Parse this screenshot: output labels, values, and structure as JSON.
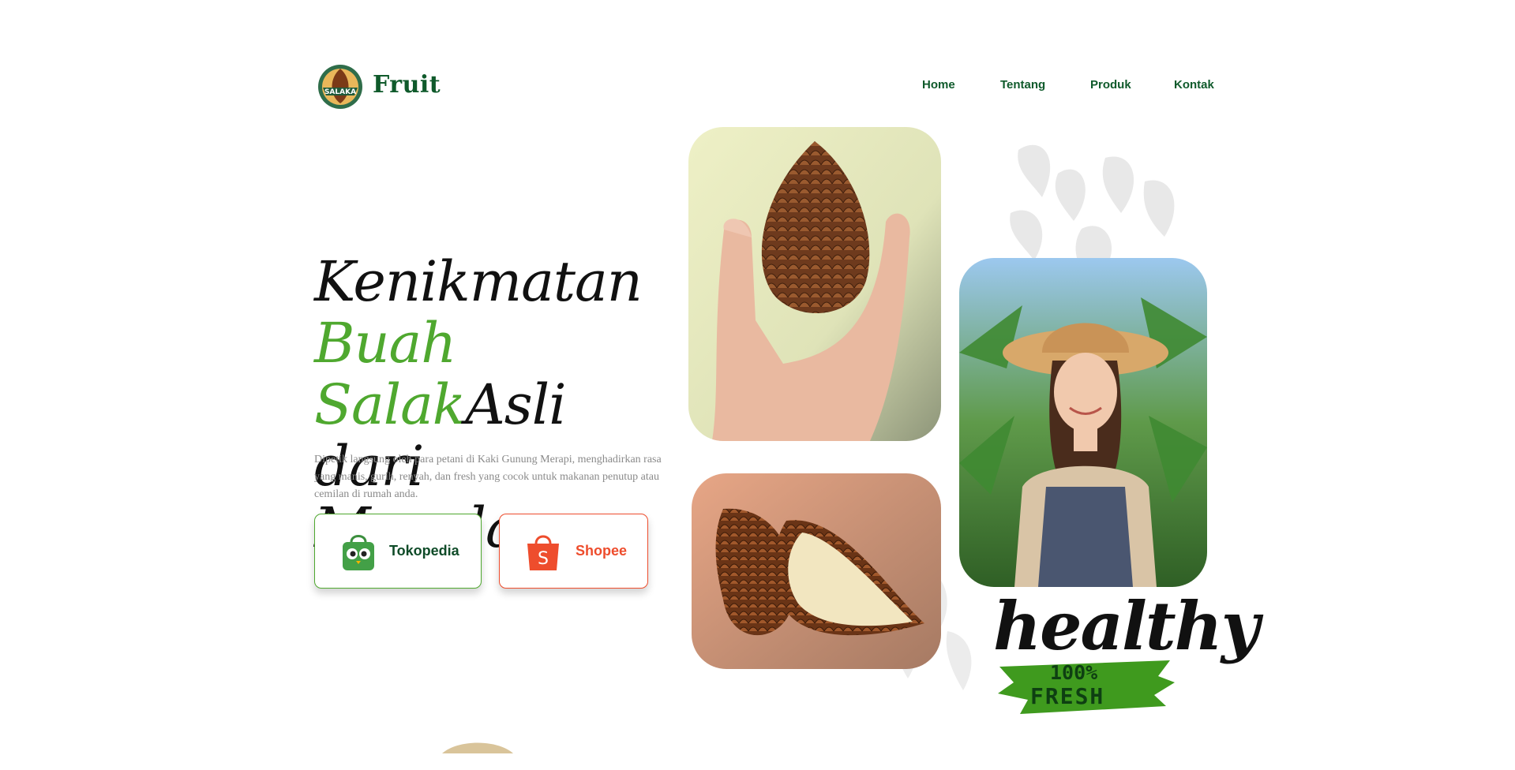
{
  "header": {
    "brand": "Fruit",
    "logo_text": "SALAKA",
    "nav": [
      "Home",
      "Tentang",
      "Produk",
      "Kontak"
    ]
  },
  "hero": {
    "title_line1": "Kenikmatan",
    "title_green": "Buah Salak",
    "title_after_green": "Asli",
    "title_line3": "dari Magelang",
    "description": "Dipetik langsung oleh para petani di Kaki Gunung Merapi, menghadirkan rasa yang manis, gurih, renyah, dan fresh yang cocok untuk makanan penutup atau cemilan di rumah anda."
  },
  "stores": {
    "tokopedia": "Tokopedia",
    "shopee": "Shopee",
    "shopee_icon_letter": "S"
  },
  "badge": {
    "healthy": "healthy",
    "percent": "100%",
    "fresh": "FRESH"
  },
  "colors": {
    "brand_green": "#0f5a2b",
    "accent_green": "#4fa82f",
    "shopee_orange": "#ee4d2d"
  }
}
